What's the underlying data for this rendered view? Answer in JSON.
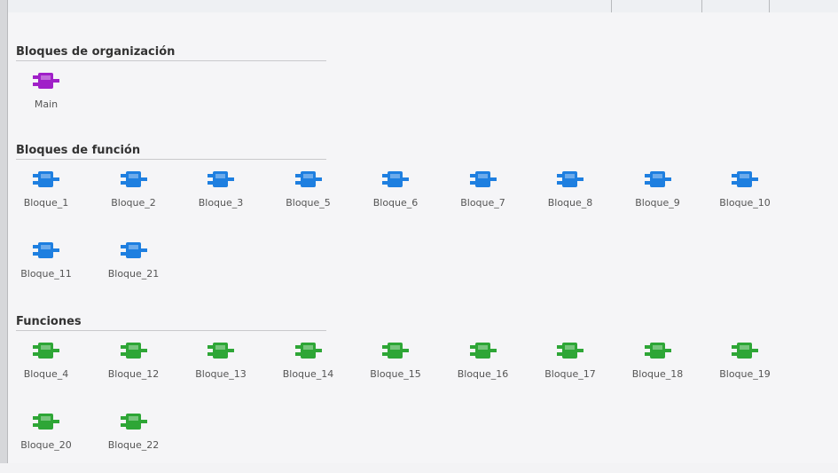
{
  "groups": [
    {
      "title": "Bloques de organización",
      "color": "#a020c8",
      "blocks": [
        "Main"
      ]
    },
    {
      "title": "Bloques de función",
      "color": "#1e7fe0",
      "blocks": [
        "Bloque_1",
        "Bloque_2",
        "Bloque_3",
        "Bloque_5",
        "Bloque_6",
        "Bloque_7",
        "Bloque_8",
        "Bloque_9",
        "Bloque_10",
        "Bloque_11",
        "Bloque_21"
      ]
    },
    {
      "title": "Funciones",
      "color": "#2ea636",
      "blocks": [
        "Bloque_4",
        "Bloque_12",
        "Bloque_13",
        "Bloque_14",
        "Bloque_15",
        "Bloque_16",
        "Bloque_17",
        "Bloque_18",
        "Bloque_19",
        "Bloque_20",
        "Bloque_22"
      ]
    }
  ]
}
